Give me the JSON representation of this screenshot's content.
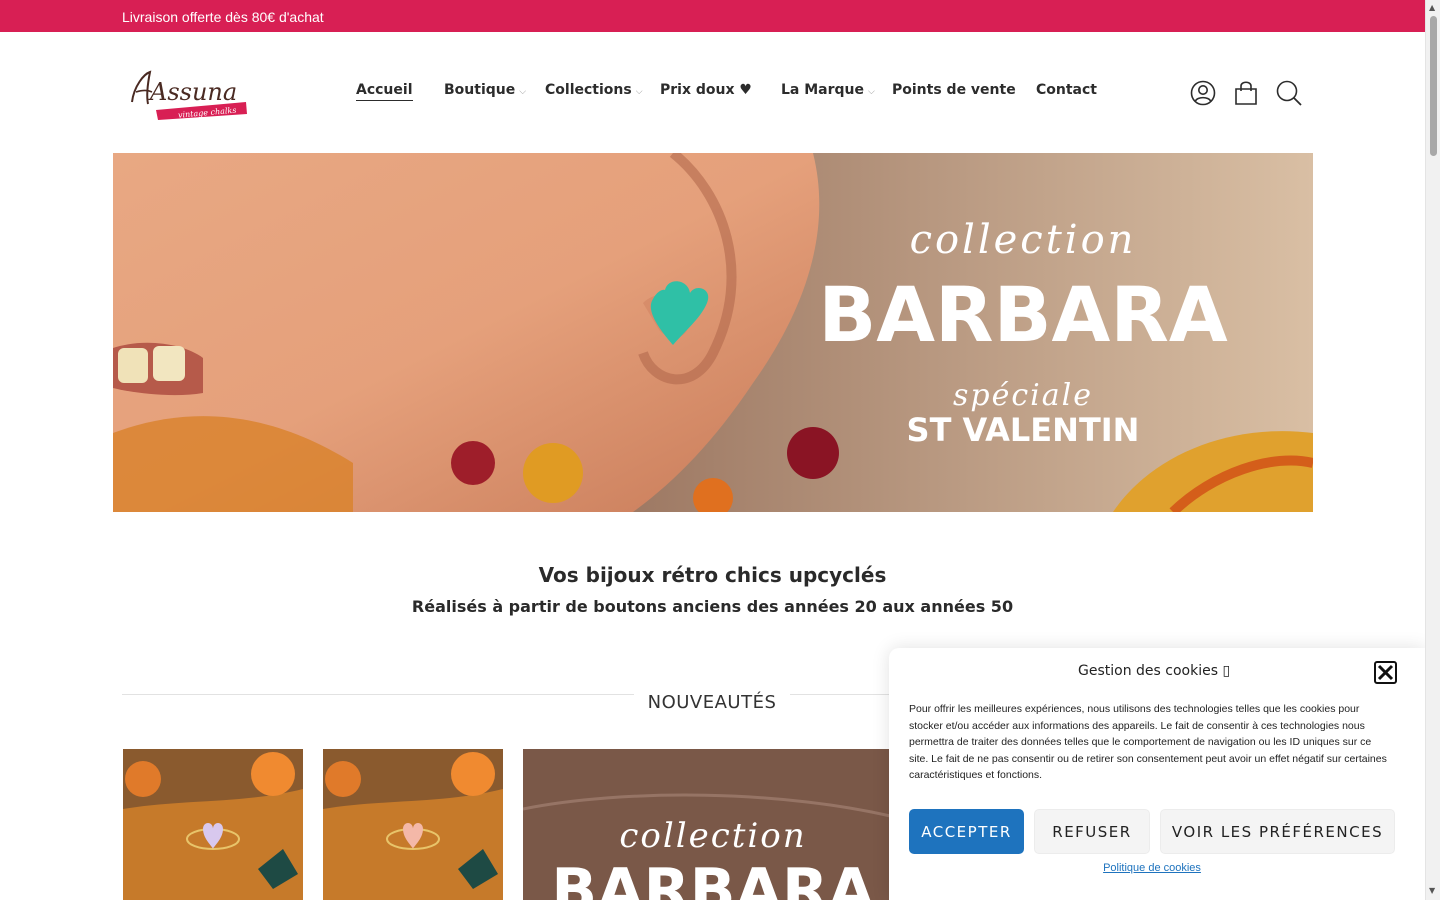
{
  "topbar": {
    "text": "Livraison offerte dès 80€ d'achat",
    "color": "#d81f54"
  },
  "logo": {
    "text": "Assuna",
    "subtext": "vintage chalks",
    "icon": "assuna-logo"
  },
  "nav": {
    "items": [
      {
        "label": "Accueil",
        "active": true,
        "has_dropdown": false
      },
      {
        "label": "Boutique",
        "active": false,
        "has_dropdown": true
      },
      {
        "label": "Collections",
        "active": false,
        "has_dropdown": true
      },
      {
        "label": "Prix doux ♥",
        "active": false,
        "has_dropdown": false
      },
      {
        "label": "La Marque",
        "active": false,
        "has_dropdown": true
      },
      {
        "label": "Points de vente",
        "active": false,
        "has_dropdown": false
      },
      {
        "label": "Contact",
        "active": false,
        "has_dropdown": false
      }
    ],
    "chevron": "⌵"
  },
  "header_icons": [
    "user-icon",
    "shopping-bag-icon",
    "search-icon"
  ],
  "hero": {
    "script_word": "collection",
    "title": "BARBARA",
    "subscript": "spéciale",
    "subtitle": "ST VALENTIN",
    "image": "model-ear-teal-heart-earring"
  },
  "tagline": {
    "line1": "Vos bijoux rétro chics upcyclés",
    "line2": "Réalisés à partir de boutons anciens des années 20 aux années 50"
  },
  "section": {
    "title": "NOUVEAUTÉS"
  },
  "products": [
    {
      "image": "lilac-heart-ring"
    },
    {
      "image": "pink-heart-ring"
    },
    {
      "image": "collection-barbara-banner",
      "script_word": "collection",
      "title": "BARBARA"
    },
    {
      "image": "product-photo"
    },
    {
      "image": "product-photo"
    }
  ],
  "cookie_banner": {
    "title": "Gestion des cookies",
    "title_suffix": "▯",
    "text": "Pour offrir les meilleures expériences, nous utilisons des technologies telles que les cookies pour stocker et/ou accéder aux informations des appareils. Le fait de consentir à ces technologies nous permettra de traiter des données telles que le comportement de navigation ou les ID uniques sur ce site. Le fait de ne pas consentir ou de retirer son consentement peut avoir un effet négatif sur certaines caractéristiques et fonctions.",
    "accept_label": "ACCEPTER",
    "refuse_label": "REFUSER",
    "prefs_label": "VOIR LES PRÉFÉRENCES",
    "policy_link": "Politique de cookies",
    "accent_color": "#1e73be"
  }
}
